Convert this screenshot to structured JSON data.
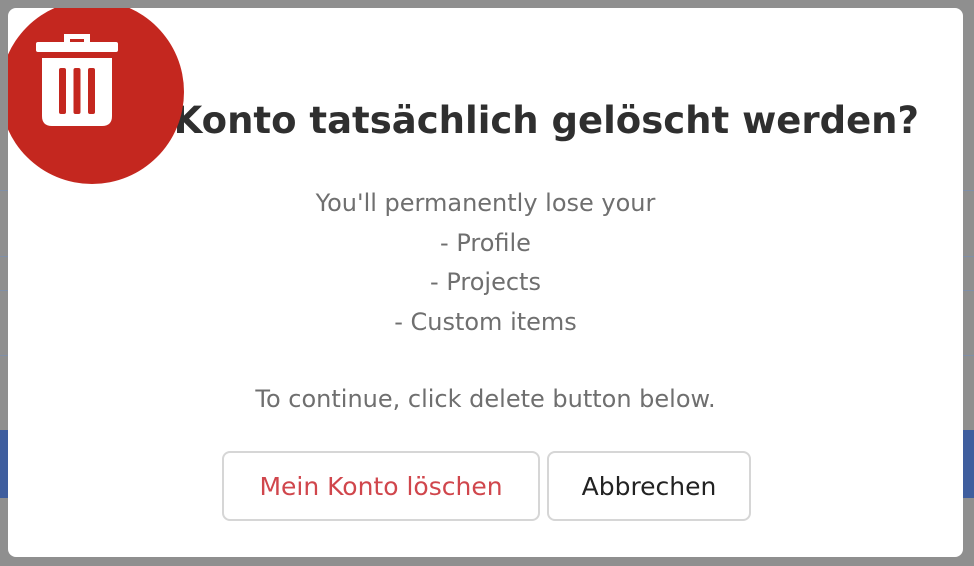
{
  "dialog": {
    "title": "as Konto tatsächlich gelöscht werden?",
    "body": {
      "intro": "You'll permanently lose your",
      "items": [
        "- Profile",
        "- Projects",
        "- Custom items"
      ],
      "instruction": "To continue, click delete button below."
    },
    "buttons": {
      "delete_label": "Mein Konto löschen",
      "cancel_label": "Abbrechen"
    },
    "badge_icon": "trash-icon"
  },
  "colors": {
    "badge": "#c4271f",
    "delete_text": "#d0464c",
    "overlay": "#8f8f8f"
  }
}
